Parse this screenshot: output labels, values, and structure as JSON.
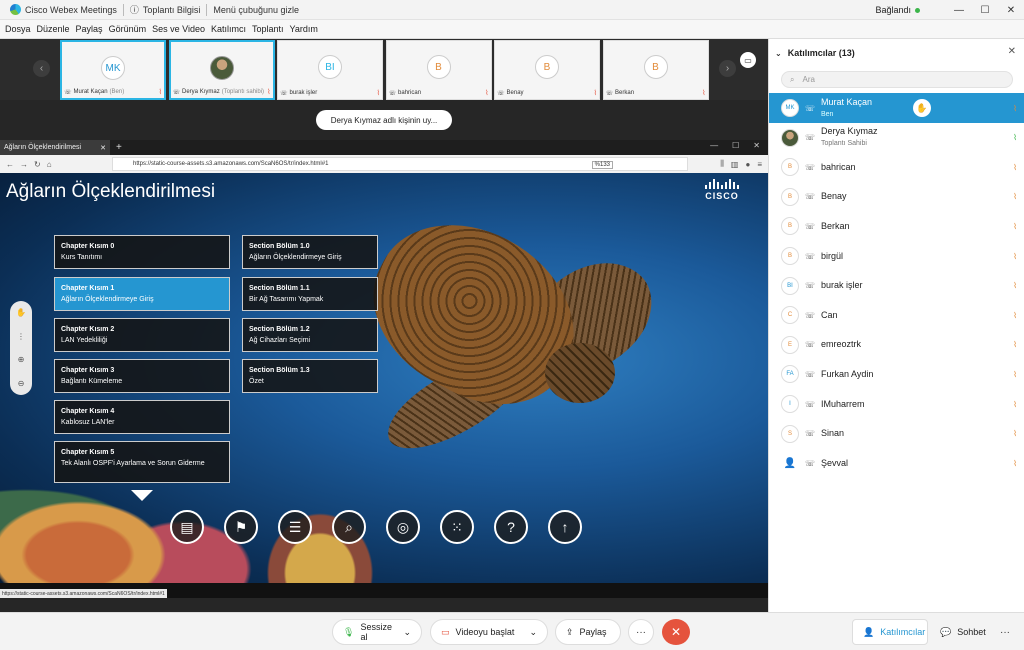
{
  "app": {
    "title": "Cisco Webex Meetings",
    "meeting_info": "Toplantı Bilgisi",
    "hide_menu": "Menü çubuğunu gizle",
    "status": "Bağlandı"
  },
  "menu": [
    "Dosya",
    "Düzenle",
    "Paylaş",
    "Görünüm",
    "Ses ve Video",
    "Katılımcı",
    "Toplantı",
    "Yardım"
  ],
  "thumbnails": [
    {
      "initials": "MK",
      "name": "Murat Kaçan",
      "sub": "(Ben)",
      "active": true,
      "photo": false
    },
    {
      "initials": "",
      "name": "Derya Kıymaz",
      "sub": "(Toplantı sahibi)",
      "active": true,
      "photo": true
    },
    {
      "initials": "BI",
      "name": "burak işler",
      "sub": "",
      "active": false,
      "photo": false
    },
    {
      "initials": "B",
      "name": "bahrican",
      "sub": "",
      "active": false,
      "photo": false
    },
    {
      "initials": "B",
      "name": "Benay",
      "sub": "",
      "active": false,
      "photo": false
    },
    {
      "initials": "B",
      "name": "Berkan",
      "sub": "",
      "active": false,
      "photo": false
    }
  ],
  "viewing_label": "Derya Kıymaz adlı kişinin uy...",
  "browser": {
    "tab_title": "Ağların Ölçeklendirilmesi",
    "url": "https://static-course-assets.s3.amazonaws.com/ScaN6OS/tr/index.html#1",
    "zoom": "%133",
    "status_url": "https://static-course-assets.s3.amazonaws.com/ScaN6OS/tr/index.html#1"
  },
  "course": {
    "title": "Ağların Ölçeklendirilmesi",
    "brand": "CISCO",
    "chapters": [
      {
        "head": "Chapter Kısım 0",
        "text": "Kurs Tanıtımı",
        "active": false
      },
      {
        "head": "Chapter Kısım 1",
        "text": "Ağların Ölçeklendirmeye Giriş",
        "active": true
      },
      {
        "head": "Chapter Kısım 2",
        "text": "LAN Yedekliliği",
        "active": false
      },
      {
        "head": "Chapter Kısım 3",
        "text": "Bağlantı Kümeleme",
        "active": false
      },
      {
        "head": "Chapter Kısım 4",
        "text": "Kablosuz LAN'ler",
        "active": false
      },
      {
        "head": "Chapter Kısım 5",
        "text": "Tek Alanlı OSPF'i Ayarlama ve Sorun Giderme",
        "active": false
      }
    ],
    "sections": [
      {
        "head": "Section Bölüm 1.0",
        "text": "Ağların Ölçeklendirmeye Giriş"
      },
      {
        "head": "Section Bölüm 1.1",
        "text": "Bir Ağ Tasarımı Yapmak"
      },
      {
        "head": "Section Bölüm 1.2",
        "text": "Ağ Cihazları Seçimi"
      },
      {
        "head": "Section Bölüm 1.3",
        "text": "Özet"
      }
    ],
    "bottom_icons": [
      "book-icon",
      "bookmark-icon",
      "menu-icon",
      "search-icon",
      "glossary-icon",
      "apps-icon",
      "help-icon",
      "up-arrow-icon"
    ]
  },
  "controls": {
    "mute": "Sessize al",
    "video": "Videoyu başlat",
    "share": "Paylaş",
    "participants": "Katılımcılar",
    "chat": "Sohbet"
  },
  "panel": {
    "title": "Katılımcılar (13)",
    "search_placeholder": "Ara",
    "participants": [
      {
        "initials": "MK",
        "name": "Murat Kaçan",
        "sub": "Ben",
        "active": true,
        "photo": false,
        "phone": false
      },
      {
        "initials": "",
        "name": "Derya Kıymaz",
        "sub": "Toplantı Sahibi",
        "active": false,
        "photo": true,
        "phone": false
      },
      {
        "initials": "B",
        "name": "bahrican",
        "sub": "",
        "active": false,
        "photo": false,
        "phone": false
      },
      {
        "initials": "B",
        "name": "Benay",
        "sub": "",
        "active": false,
        "photo": false,
        "phone": false
      },
      {
        "initials": "B",
        "name": "Berkan",
        "sub": "",
        "active": false,
        "photo": false,
        "phone": false
      },
      {
        "initials": "B",
        "name": "birgül",
        "sub": "",
        "active": false,
        "photo": false,
        "phone": false
      },
      {
        "initials": "BI",
        "name": "burak işler",
        "sub": "",
        "active": false,
        "photo": false,
        "phone": false
      },
      {
        "initials": "C",
        "name": "Can",
        "sub": "",
        "active": false,
        "photo": false,
        "phone": false
      },
      {
        "initials": "E",
        "name": "emreoztrk",
        "sub": "",
        "active": false,
        "photo": false,
        "phone": false
      },
      {
        "initials": "FA",
        "name": "Furkan Aydin",
        "sub": "",
        "active": false,
        "photo": false,
        "phone": false
      },
      {
        "initials": "I",
        "name": "IMuharrem",
        "sub": "",
        "active": false,
        "photo": false,
        "phone": false
      },
      {
        "initials": "S",
        "name": "Sinan",
        "sub": "",
        "active": false,
        "photo": false,
        "phone": false
      },
      {
        "initials": "",
        "name": "Şevval",
        "sub": "",
        "active": false,
        "photo": false,
        "phone": true
      }
    ]
  }
}
